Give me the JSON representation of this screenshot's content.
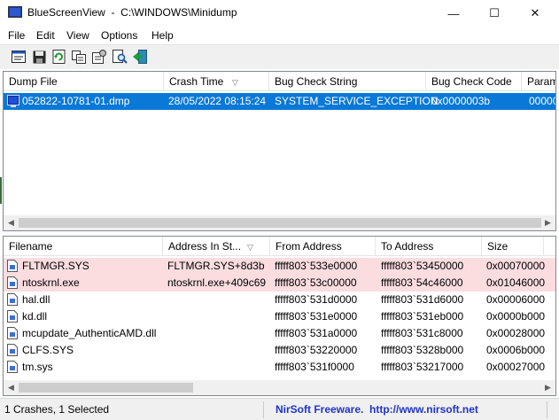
{
  "window": {
    "title": "BlueScreenView  -  C:\\WINDOWS\\Minidump",
    "minimize": "—",
    "maximize": "☐",
    "close": "✕"
  },
  "menu": [
    "File",
    "Edit",
    "View",
    "Options",
    "Help"
  ],
  "toolbar": {
    "icons": [
      "properties-icon",
      "save-icon",
      "refresh-icon",
      "copy-icon",
      "report-icon",
      "find-icon",
      "exit-icon"
    ]
  },
  "dump_list": {
    "columns": [
      "Dump File",
      "Crash Time",
      "Bug Check String",
      "Bug Check Code",
      "Param"
    ],
    "sort_indicator": "▽",
    "rows": [
      {
        "dump_file": "052822-10781-01.dmp",
        "crash_time": "28/05/2022 08:15:24",
        "bug_check_string": "SYSTEM_SERVICE_EXCEPTION",
        "bug_check_code": "0x0000003b",
        "param": "00000"
      }
    ]
  },
  "driver_list": {
    "columns": [
      "Filename",
      "Address In St...",
      "From Address",
      "To Address",
      "Size"
    ],
    "sort_indicator": "▽",
    "rows": [
      {
        "filename": "FLTMGR.SYS",
        "address_in_stack": "FLTMGR.SYS+8d3b",
        "from": "fffff803`533e0000",
        "to": "fffff803`53450000",
        "size": "0x00070000",
        "highlight": true
      },
      {
        "filename": "ntoskrnl.exe",
        "address_in_stack": "ntoskrnl.exe+409c69",
        "from": "fffff803`53c00000",
        "to": "fffff803`54c46000",
        "size": "0x01046000",
        "highlight": true
      },
      {
        "filename": "hal.dll",
        "address_in_stack": "",
        "from": "fffff803`531d0000",
        "to": "fffff803`531d6000",
        "size": "0x00006000",
        "highlight": false
      },
      {
        "filename": "kd.dll",
        "address_in_stack": "",
        "from": "fffff803`531e0000",
        "to": "fffff803`531eb000",
        "size": "0x0000b000",
        "highlight": false
      },
      {
        "filename": "mcupdate_AuthenticAMD.dll",
        "address_in_stack": "",
        "from": "fffff803`531a0000",
        "to": "fffff803`531c8000",
        "size": "0x00028000",
        "highlight": false
      },
      {
        "filename": "CLFS.SYS",
        "address_in_stack": "",
        "from": "fffff803`53220000",
        "to": "fffff803`5328b000",
        "size": "0x0006b000",
        "highlight": false
      },
      {
        "filename": "tm.sys",
        "address_in_stack": "",
        "from": "fffff803`531f0000",
        "to": "fffff803`53217000",
        "size": "0x00027000",
        "highlight": false
      }
    ]
  },
  "status": {
    "summary": "1 Crashes, 1 Selected",
    "credit": "NirSoft Freeware.  http://www.nirsoft.net"
  },
  "colors": {
    "selection": "#0a78d7",
    "highlight_row": "#fbdde0",
    "link": "#1f33c8"
  }
}
